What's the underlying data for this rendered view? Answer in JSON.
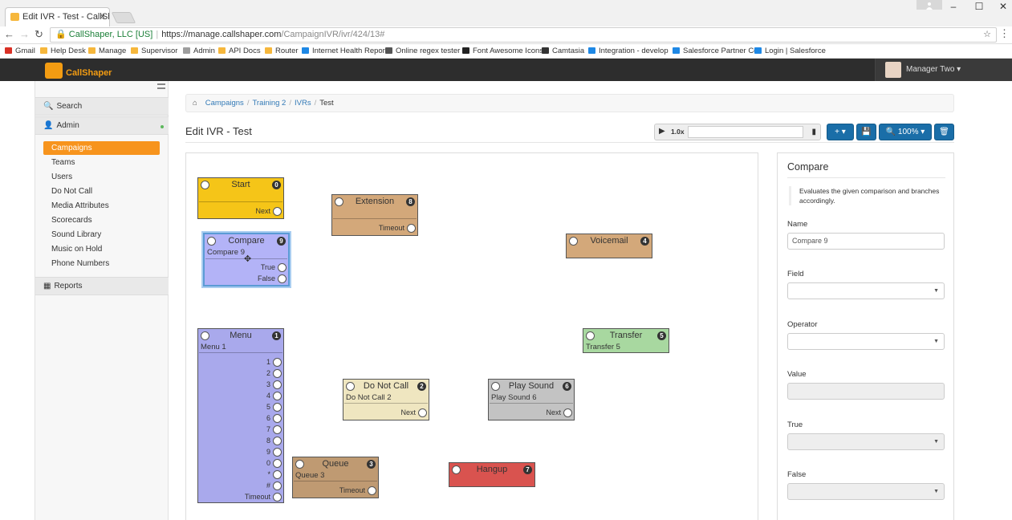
{
  "browser": {
    "tab_title": "Edit IVR - Test - CallShap",
    "tab_close": "×",
    "site_identity": "CallShaper, LLC [US]",
    "url_host": "https://manage.callshaper.com",
    "url_path": "/CampaignIVR/ivr/424/13#",
    "bookmarks": [
      {
        "label": "Gmail",
        "color": "#d93025"
      },
      {
        "label": "Help Desk",
        "color": "#f6b73c"
      },
      {
        "label": "Manage",
        "color": "#f6b73c"
      },
      {
        "label": "Supervisor",
        "color": "#f6b73c"
      },
      {
        "label": "Admin",
        "color": "#9e9e9e"
      },
      {
        "label": "API Docs",
        "color": "#f6b73c"
      },
      {
        "label": "Router",
        "color": "#f6b73c"
      },
      {
        "label": "Internet Health Repor",
        "color": "#1e88e5"
      },
      {
        "label": "Online regex tester",
        "color": "#555555"
      },
      {
        "label": "Font Awesome Icons",
        "color": "#222222"
      },
      {
        "label": "Camtasia",
        "color": "#333333"
      },
      {
        "label": "Integration - develop",
        "color": "#1e88e5"
      },
      {
        "label": "Salesforce Partner Co",
        "color": "#1e88e5"
      },
      {
        "label": "Login | Salesforce",
        "color": "#1e88e5"
      }
    ]
  },
  "header": {
    "logo_text": "CallShaper",
    "user_name": "Manager Two ▾"
  },
  "sidebar": {
    "search_label": "Search",
    "admin_label": "Admin",
    "items": [
      "Campaigns",
      "Teams",
      "Users",
      "Do Not Call",
      "Media Attributes",
      "Scorecards",
      "Sound Library",
      "Music on Hold",
      "Phone Numbers"
    ],
    "active_item": "Campaigns",
    "reports_label": "Reports"
  },
  "breadcrumb": [
    "Campaigns",
    "Training 2",
    "IVRs",
    "Test"
  ],
  "page_title": "Edit IVR - Test",
  "player": {
    "rate": "1.0x"
  },
  "toolbar": {
    "add_label": "+ ▾",
    "zoom_label": "100% ▾"
  },
  "nodes": {
    "start": {
      "title": "Start",
      "num": "0",
      "outputs": [
        "Next"
      ]
    },
    "extension": {
      "title": "Extension",
      "num": "8",
      "outputs": [
        "Timeout"
      ]
    },
    "compare": {
      "title": "Compare",
      "num": "9",
      "name": "Compare 9",
      "outputs": [
        "True",
        "False"
      ]
    },
    "voicemail": {
      "title": "Voicemail",
      "num": "4"
    },
    "menu": {
      "title": "Menu",
      "num": "1",
      "name": "Menu 1",
      "outputs": [
        "1",
        "2",
        "3",
        "4",
        "5",
        "6",
        "7",
        "8",
        "9",
        "0",
        "*",
        "#",
        "Timeout"
      ]
    },
    "transfer": {
      "title": "Transfer",
      "num": "5",
      "name": "Transfer 5"
    },
    "dnc": {
      "title": "Do Not Call",
      "num": "2",
      "name": "Do Not Call 2",
      "outputs": [
        "Next"
      ]
    },
    "playsound": {
      "title": "Play Sound",
      "num": "6",
      "name": "Play Sound 6",
      "outputs": [
        "Next"
      ]
    },
    "queue": {
      "title": "Queue",
      "num": "3",
      "name": "Queue 3",
      "outputs": [
        "Timeout"
      ]
    },
    "hangup": {
      "title": "Hangup",
      "num": "7"
    }
  },
  "colors": {
    "start": "#f5c518",
    "extension": "#d3a87a",
    "compare": "#b3b3f7",
    "voicemail": "#d3a87a",
    "menu": "#a9a9ec",
    "transfer": "#a8d8a0",
    "dnc": "#efe6c0",
    "playsound": "#c3c3c3",
    "queue": "#bf9a72",
    "hangup": "#d9534f",
    "accent": "#f7941d",
    "primary": "#1a6ea8"
  },
  "props": {
    "title": "Compare",
    "description": "Evaluates the given comparison and branches accordingly.",
    "name_label": "Name",
    "name_value": "Compare 9",
    "field_label": "Field",
    "operator_label": "Operator",
    "value_label": "Value",
    "true_label": "True",
    "false_label": "False"
  }
}
